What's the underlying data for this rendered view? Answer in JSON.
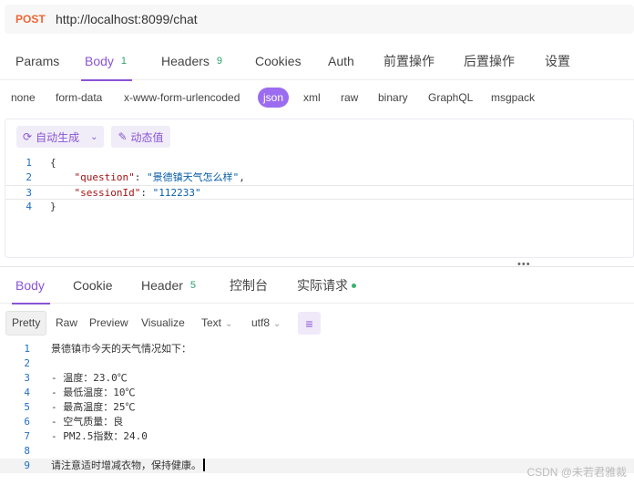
{
  "request": {
    "method": "POST",
    "url": "http://localhost:8099/chat"
  },
  "request_tabs": [
    {
      "label": "Params",
      "badge": ""
    },
    {
      "label": "Body",
      "badge": "1"
    },
    {
      "label": "Headers",
      "badge": "9"
    },
    {
      "label": "Cookies",
      "badge": ""
    },
    {
      "label": "Auth",
      "badge": ""
    },
    {
      "label": "前置操作",
      "badge": ""
    },
    {
      "label": "后置操作",
      "badge": ""
    },
    {
      "label": "设置",
      "badge": ""
    }
  ],
  "body_types": [
    "none",
    "form-data",
    "x-www-form-urlencoded",
    "json",
    "xml",
    "raw",
    "binary",
    "GraphQL",
    "msgpack"
  ],
  "editor": {
    "auto_generate": "自动生成",
    "dynamic_value": "动态值",
    "lines": [
      {
        "n": "1",
        "text": "{"
      },
      {
        "n": "2",
        "key": "\"question\"",
        "value": "\"景德镇天气怎么样\"",
        "tail": ","
      },
      {
        "n": "3",
        "key": "\"sessionId\"",
        "value": "\"112233\"",
        "tail": ""
      },
      {
        "n": "4",
        "text": "}"
      }
    ]
  },
  "response_tabs": [
    {
      "label": "Body",
      "badge": ""
    },
    {
      "label": "Cookie",
      "badge": ""
    },
    {
      "label": "Header",
      "badge": "5"
    },
    {
      "label": "控制台",
      "badge": ""
    },
    {
      "label": "实际请求",
      "badge": ""
    }
  ],
  "view_modes": [
    "Pretty",
    "Raw",
    "Preview",
    "Visualize"
  ],
  "format_select": "Text",
  "encoding_select": "utf8",
  "response_lines": [
    {
      "n": "1",
      "text": "景德镇市今天的天气情况如下："
    },
    {
      "n": "2",
      "text": ""
    },
    {
      "n": "3",
      "text": "- 温度：23.0℃"
    },
    {
      "n": "4",
      "text": "- 最低温度：10℃"
    },
    {
      "n": "5",
      "text": "- 最高温度：25℃"
    },
    {
      "n": "6",
      "text": "- 空气质量：良"
    },
    {
      "n": "7",
      "text": "- PM2.5指数：24.0"
    },
    {
      "n": "8",
      "text": ""
    },
    {
      "n": "9",
      "text": "请注意适时增减衣物，保持健康。"
    }
  ],
  "watermark": "CSDN @未若君雅裁",
  "colors": {
    "accent": "#8a54d6",
    "method": "#ee6633",
    "status_dot": "#3bb36b"
  }
}
